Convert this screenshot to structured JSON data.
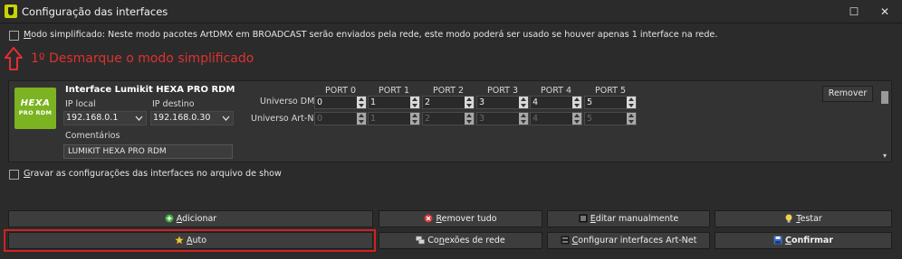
{
  "window": {
    "title": "Configuração das interfaces",
    "maximize_glyph": "☐",
    "close_glyph": "✕"
  },
  "simplified_mode": {
    "label_prefix": "M",
    "label_rest": "odo simplificado: Neste modo pacotes ArtDMX em BROADCAST serão enviados pela rede, este modo poderá ser usado se houver apenas 1 interface na rede.",
    "checked": false
  },
  "annotation": {
    "text": "1º Desmarque o modo simplificado",
    "color": "#e03030"
  },
  "interface": {
    "logo_text_1": "HEXA",
    "logo_text_2": "PRO RDM",
    "name": "Interface Lumikit HEXA PRO RDM",
    "local_ip_label": "IP local",
    "local_ip": "192.168.0.1",
    "dest_ip_label": "IP destino",
    "dest_ip": "192.168.0.30",
    "comments_label": "Comentários",
    "comments": "LUMIKIT HEXA PRO RDM",
    "universe_dmx_label": "Universo DMX",
    "universe_artnet_label": "Universo Art-Net",
    "remove_label": "Remover",
    "ports": [
      {
        "label": "PORT 0",
        "dmx": "0",
        "artnet": "0"
      },
      {
        "label": "PORT 1",
        "dmx": "1",
        "artnet": "1"
      },
      {
        "label": "PORT 2",
        "dmx": "2",
        "artnet": "2"
      },
      {
        "label": "PORT 3",
        "dmx": "3",
        "artnet": "3"
      },
      {
        "label": "PORT 4",
        "dmx": "4",
        "artnet": "4"
      },
      {
        "label": "PORT 5",
        "dmx": "5",
        "artnet": "5"
      }
    ]
  },
  "save_in_show": {
    "prefix": "G",
    "rest": "ravar as configurações das interfaces no arquivo de show",
    "checked": false
  },
  "buttons": {
    "add": {
      "prefix": "A",
      "rest": "dicionar",
      "icon": "plus-circle-icon"
    },
    "remove_all": {
      "prefix": "R",
      "rest": "emover tudo",
      "icon": "remove-circle-icon"
    },
    "edit_manually": {
      "prefix": "E",
      "rest": "ditar manualmente",
      "icon": "list-icon"
    },
    "test": {
      "prefix": "T",
      "rest": "estar",
      "icon": "lightbulb-icon"
    },
    "auto": {
      "prefix": "A",
      "rest": "uto",
      "icon": "star-icon"
    },
    "network_connections": {
      "prefix": "Co",
      "under": "n",
      "rest": "exões de rede",
      "icon": "network-icon"
    },
    "configure_artnet": {
      "prefix": "C",
      "rest": "onfigurar interfaces Art-Net",
      "icon": "artnet-icon"
    },
    "confirm": {
      "prefix": "C",
      "rest": "onfirmar",
      "icon": "save-icon"
    }
  },
  "colors": {
    "background": "#2b2b2b",
    "panel": "#333333",
    "highlight_box": "#d42020",
    "logo_green": "#7cb320"
  }
}
